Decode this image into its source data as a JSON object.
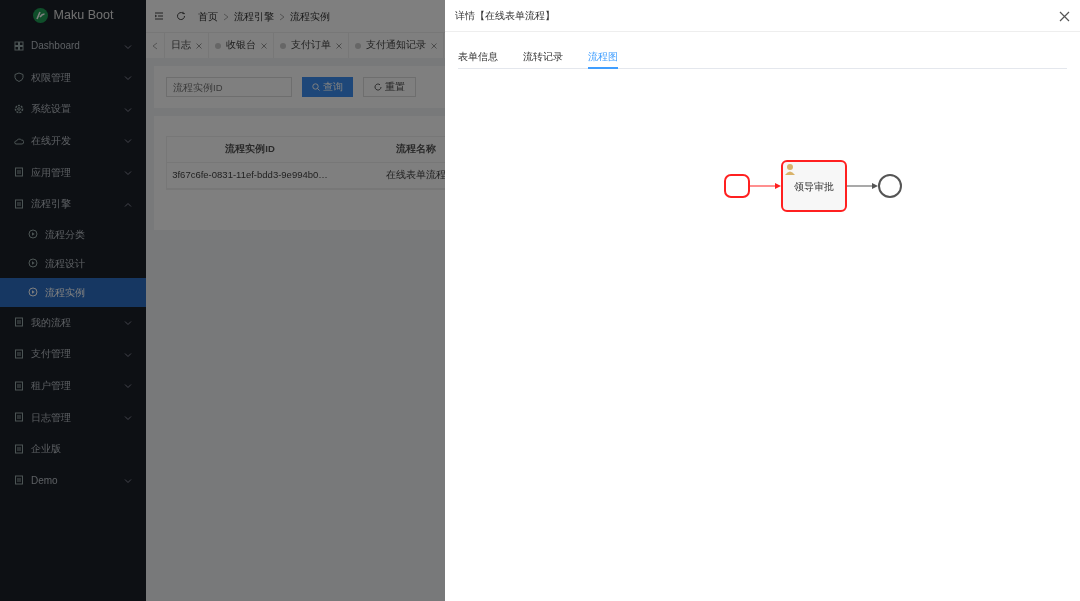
{
  "brand": "Maku Boot",
  "sidebar": {
    "items": [
      {
        "label": "Dashboard",
        "expanded": false,
        "selected": false
      },
      {
        "label": "权限管理",
        "expanded": false,
        "selected": false
      },
      {
        "label": "系统设置",
        "expanded": false,
        "selected": false
      },
      {
        "label": "在线开发",
        "expanded": false,
        "selected": false
      },
      {
        "label": "应用管理",
        "expanded": false,
        "selected": false
      },
      {
        "label": "流程引擎",
        "expanded": true,
        "selected": false,
        "children": [
          {
            "label": "流程分类",
            "selected": false
          },
          {
            "label": "流程设计",
            "selected": false
          },
          {
            "label": "流程实例",
            "selected": true
          }
        ]
      },
      {
        "label": "我的流程",
        "expanded": false,
        "selected": false
      },
      {
        "label": "支付管理",
        "expanded": false,
        "selected": false
      },
      {
        "label": "租户管理",
        "expanded": false,
        "selected": false
      },
      {
        "label": "日志管理",
        "expanded": false,
        "selected": false
      },
      {
        "label": "企业版",
        "selected": false
      },
      {
        "label": "Demo",
        "expanded": false,
        "selected": false
      }
    ]
  },
  "breadcrumb": [
    "首页",
    "流程引擎",
    "流程实例"
  ],
  "page_tabs": [
    {
      "label": "日志",
      "selected": false
    },
    {
      "label": "收银台",
      "selected": false
    },
    {
      "label": "支付订单",
      "selected": false
    },
    {
      "label": "支付通知记录",
      "selected": false
    }
  ],
  "search": {
    "placeholder": "流程实例ID",
    "query_button": "查询",
    "reset_button": "重置"
  },
  "table": {
    "columns": [
      "流程实例ID",
      "流程名称"
    ],
    "rows": [
      [
        "3f67c6fe-0831-11ef-bdd3-9e994b0…",
        "在线表单流程"
      ]
    ]
  },
  "drawer": {
    "title": "详情【在线表单流程】",
    "tabs": [
      {
        "label": "表单信息",
        "selected": false
      },
      {
        "label": "流转记录",
        "selected": false
      },
      {
        "label": "流程图",
        "selected": true
      }
    ],
    "diagram": {
      "nodes": [
        {
          "kind": "start",
          "highlighted": true
        },
        {
          "kind": "task",
          "label": "领导审批",
          "highlighted": true
        },
        {
          "kind": "end",
          "highlighted": false
        }
      ],
      "edges": [
        {
          "highlighted": true
        },
        {
          "highlighted": false
        }
      ]
    }
  }
}
